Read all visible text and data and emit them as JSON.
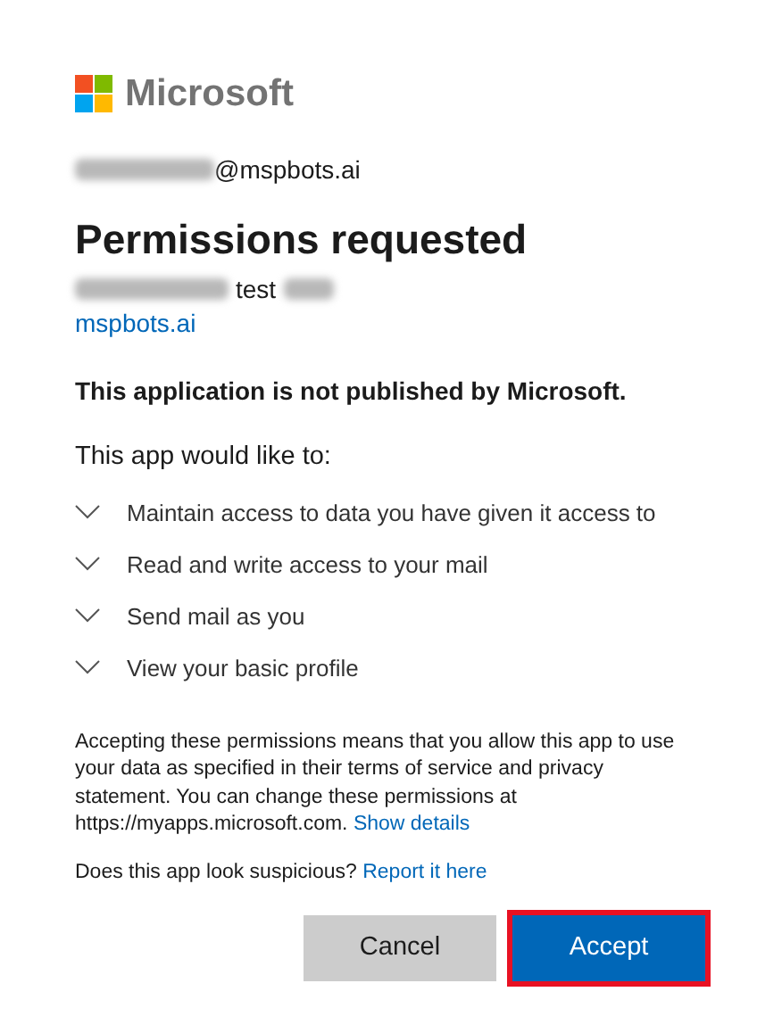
{
  "brand": {
    "name": "Microsoft"
  },
  "account": {
    "email_suffix": "@mspbots.ai"
  },
  "title": "Permissions requested",
  "app": {
    "name_visible": "test",
    "publisher_link": "mspbots.ai"
  },
  "warning": "This application is not published by Microsoft.",
  "intro": "This app would like to:",
  "permissions": [
    {
      "label": "Maintain access to data you have given it access to",
      "expanded": false
    },
    {
      "label": "Read and write access to your mail",
      "expanded": false
    },
    {
      "label": "Send mail as you",
      "expanded": false
    },
    {
      "label": "View your basic profile",
      "expanded": false
    }
  ],
  "consent": {
    "text": "Accepting these permissions means that you allow this app to use your data as specified in their terms of service and privacy statement. You can change these permissions at https://myapps.microsoft.com.",
    "link": "Show details"
  },
  "report": {
    "text": "Does this app look suspicious?",
    "link": "Report it here"
  },
  "buttons": [
    {
      "label": "Cancel",
      "kind": "secondary",
      "highlighted": false
    },
    {
      "label": "Accept",
      "kind": "primary",
      "highlighted": true
    }
  ]
}
